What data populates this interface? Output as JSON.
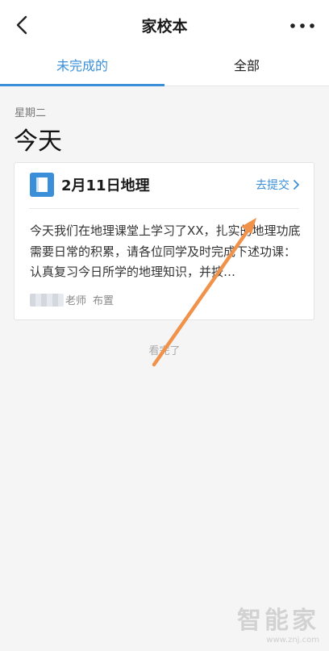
{
  "header": {
    "title": "家校本",
    "back_icon": "chevron-left-icon",
    "more_icon": "more-dots-icon"
  },
  "tabs": [
    {
      "label": "未完成的",
      "active": true
    },
    {
      "label": "全部",
      "active": false
    }
  ],
  "section": {
    "weekday": "星期二",
    "day_label": "今天"
  },
  "card": {
    "icon": "book-icon",
    "title": "2月11日地理",
    "action_label": "去提交",
    "body": "今天我们在地理课堂上学习了XX，扎实的地理功底需要日常的积累，请各位同学及时完成下述功课：认真复习今日所学的地理知识，并按…",
    "teacher_suffix": "老师",
    "assign_label": "布置"
  },
  "list_end_text": "看完了",
  "watermark": {
    "brand": "智能家",
    "url": "www.znj.com"
  },
  "colors": {
    "accent": "#3a8fd8",
    "annotation_arrow": "#f0924a"
  }
}
